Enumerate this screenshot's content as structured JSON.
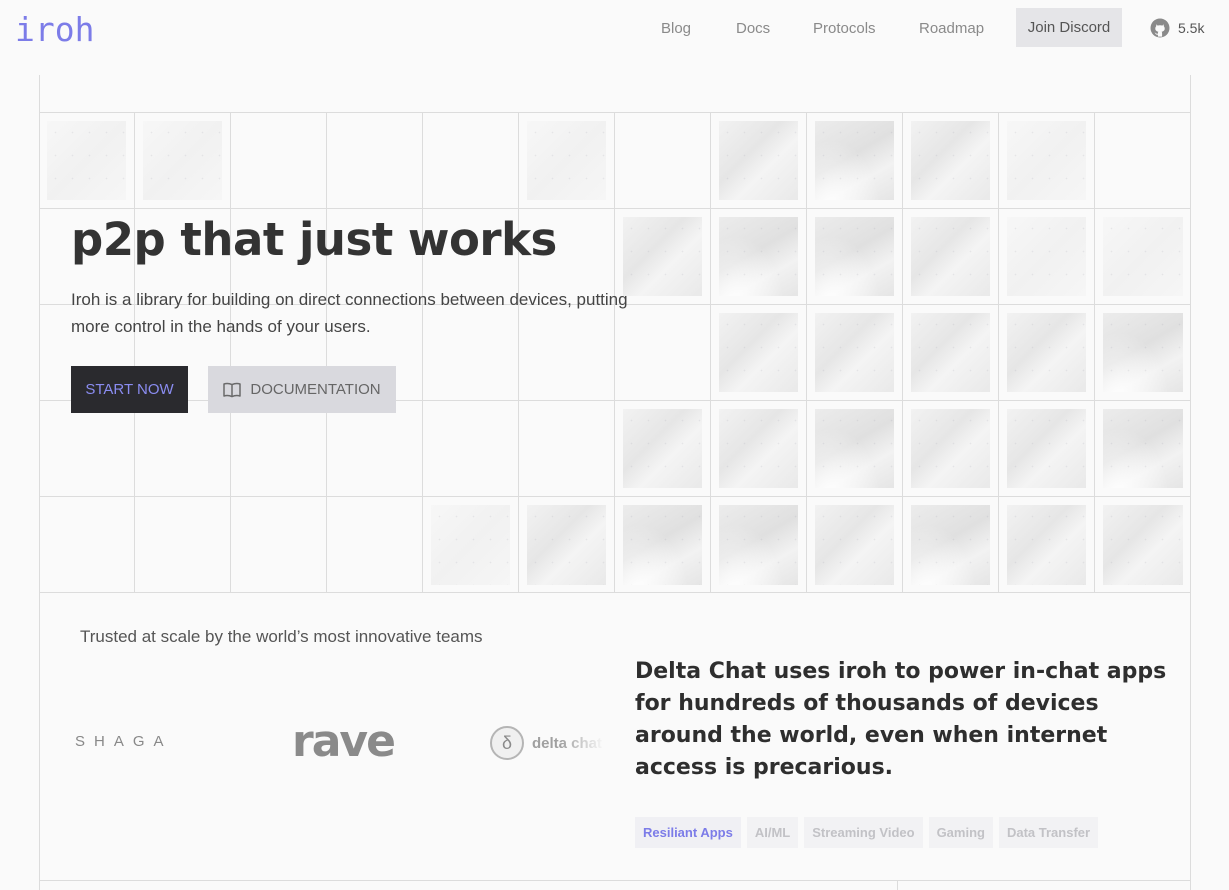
{
  "header": {
    "logo": "iroh",
    "nav": [
      "Blog",
      "Docs",
      "Protocols",
      "Roadmap"
    ],
    "discord_label": "Join Discord",
    "github_stars": "5.5k"
  },
  "hero": {
    "title": "p2p that just works",
    "subtitle": "Iroh is a library for building on direct connections between devices, putting more control in the hands of your users.",
    "start_label": "START NOW",
    "docs_label": "DOCUMENTATION"
  },
  "trusted": {
    "heading": "Trusted at scale by the world’s most innovative teams",
    "logos": [
      "SHAGA",
      "rave",
      "delta chat"
    ],
    "quote": "Delta Chat uses iroh to power in-chat apps for hundreds of thousands of devices around the world, even when internet access is precarious.",
    "tags": [
      "Resiliant Apps",
      "AI/ML",
      "Streaming Video",
      "Gaming",
      "Data Transfer"
    ]
  },
  "colors": {
    "accent": "#7c7ce8",
    "dark_button": "#2a2a2e",
    "background": "#fafafa"
  },
  "icons": [
    "github-icon",
    "book-icon",
    "delta-chat-logo-icon"
  ]
}
